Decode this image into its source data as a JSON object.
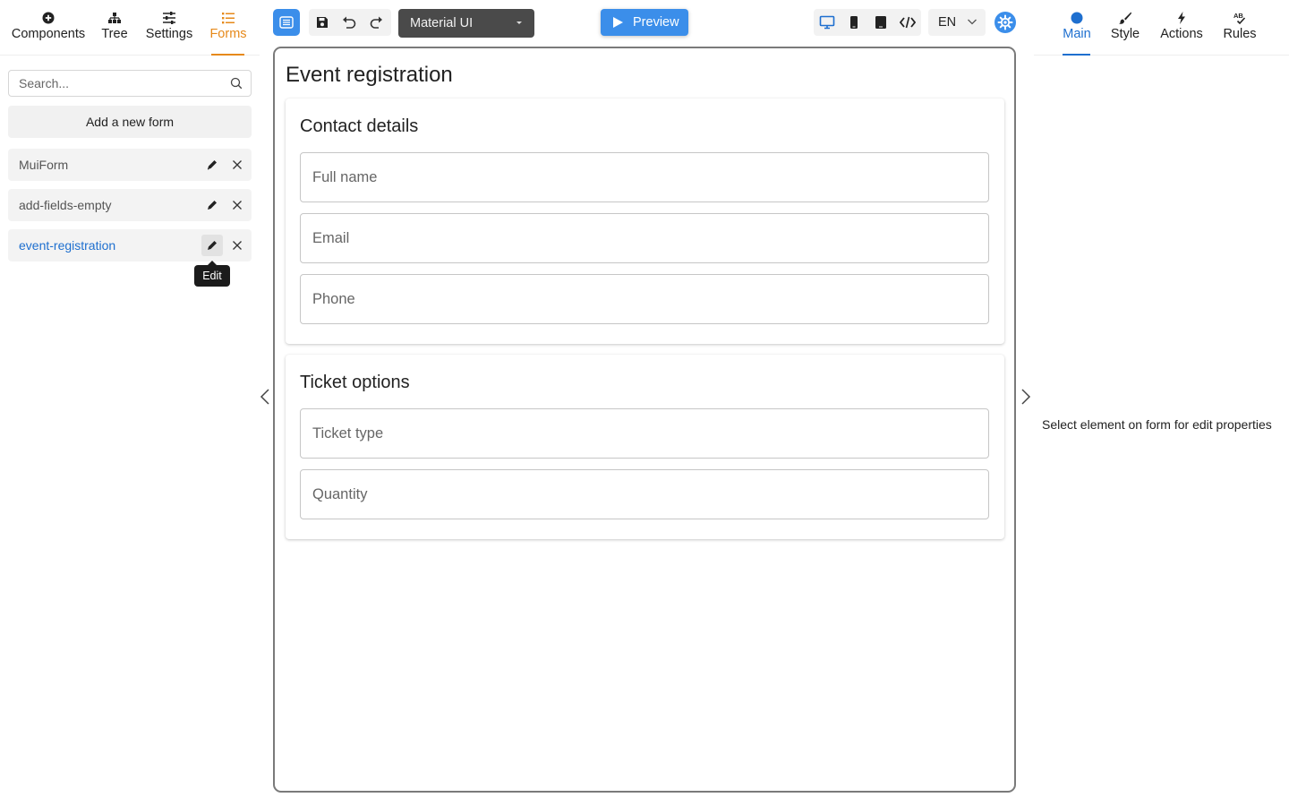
{
  "left_tabs": [
    {
      "label": "Components",
      "icon": "plus-circle-icon"
    },
    {
      "label": "Tree",
      "icon": "tree-icon"
    },
    {
      "label": "Settings",
      "icon": "sliders-icon"
    },
    {
      "label": "Forms",
      "icon": "list-icon",
      "active": true
    }
  ],
  "search": {
    "placeholder": "Search..."
  },
  "add_form_label": "Add a new form",
  "forms": [
    {
      "name": "MuiForm"
    },
    {
      "name": "add-fields-empty"
    },
    {
      "name": "event-registration",
      "active": true
    }
  ],
  "tooltip": "Edit",
  "toolbar": {
    "theme_value": "Material UI",
    "preview_label": "Preview",
    "language_value": "EN"
  },
  "form": {
    "title": "Event registration",
    "sections": [
      {
        "title": "Contact details",
        "fields": [
          "Full name",
          "Email",
          "Phone"
        ]
      },
      {
        "title": "Ticket options",
        "fields": [
          "Ticket type",
          "Quantity"
        ]
      }
    ]
  },
  "right_tabs": [
    {
      "label": "Main",
      "icon": "dot-icon",
      "active": true
    },
    {
      "label": "Style",
      "icon": "brush-icon"
    },
    {
      "label": "Actions",
      "icon": "lightning-icon"
    },
    {
      "label": "Rules",
      "icon": "spellcheck-icon"
    }
  ],
  "right_message": "Select element on form for edit properties",
  "colors": {
    "accent_blue": "#3b8eea",
    "link_blue": "#1e6fcf",
    "forms_orange": "#e6891a",
    "theme_select_bg": "#4a4a4a"
  }
}
